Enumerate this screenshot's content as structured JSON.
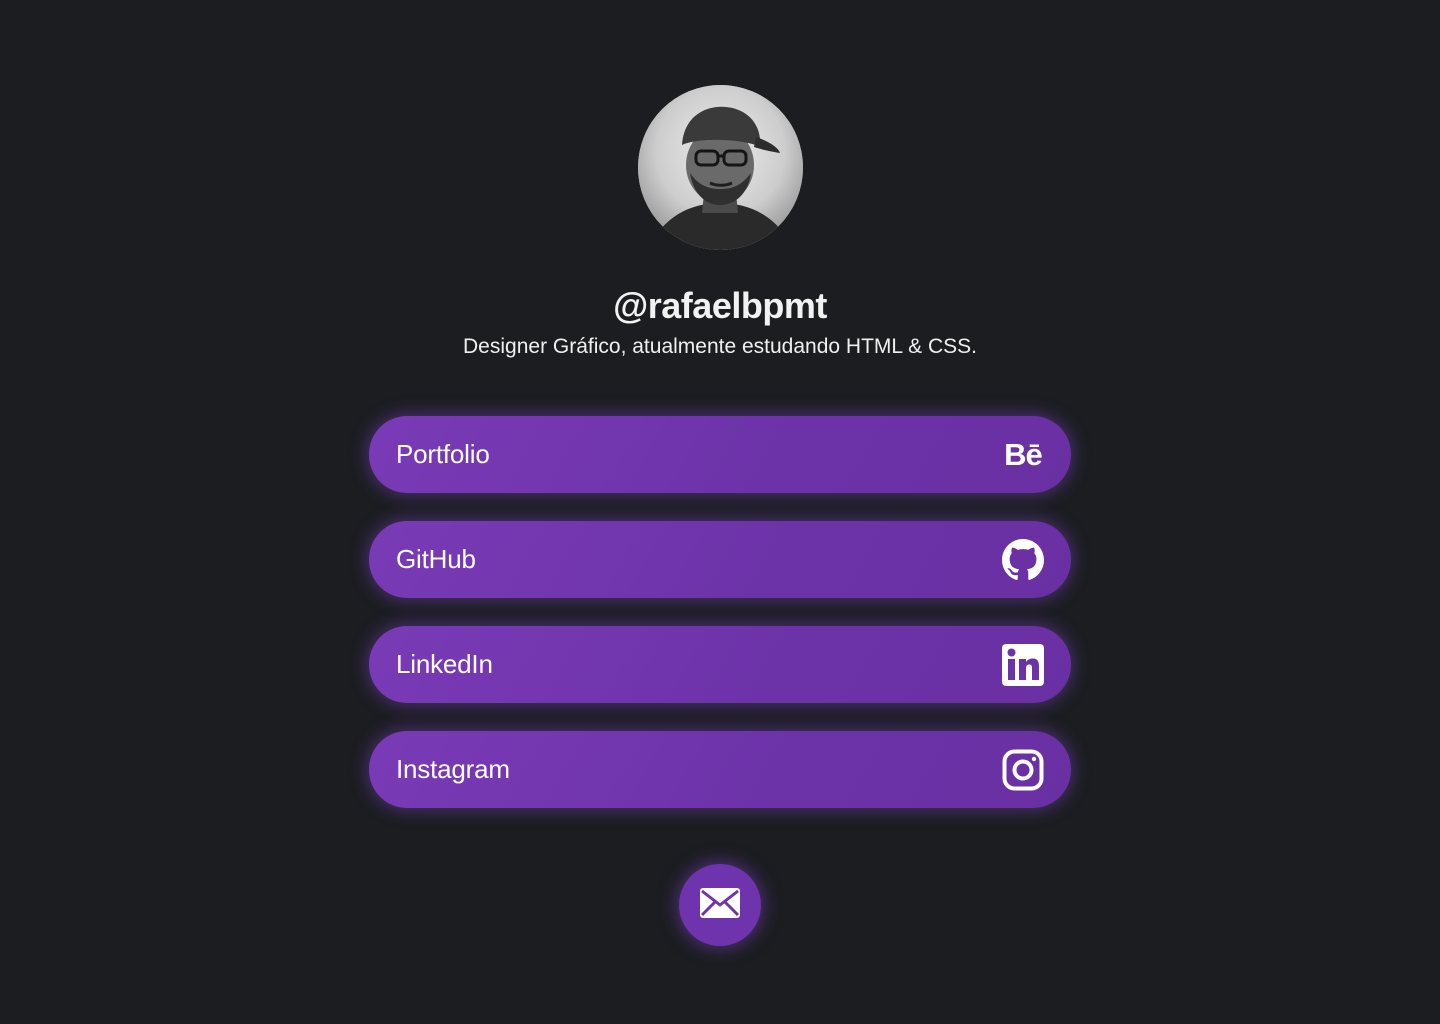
{
  "profile": {
    "username": "@rafaelbpmt",
    "bio": "Designer Gráfico, atualmente estudando HTML & CSS."
  },
  "links": [
    {
      "label": "Portfolio",
      "icon": "behance-icon",
      "icon_text": "Bē"
    },
    {
      "label": "GitHub",
      "icon": "github-icon"
    },
    {
      "label": "LinkedIn",
      "icon": "linkedin-icon"
    },
    {
      "label": "Instagram",
      "icon": "instagram-icon"
    }
  ],
  "contact": {
    "icon": "mail-icon"
  },
  "colors": {
    "background": "#1b1d20",
    "accent": "#6f33ad",
    "text": "#ffffff"
  }
}
